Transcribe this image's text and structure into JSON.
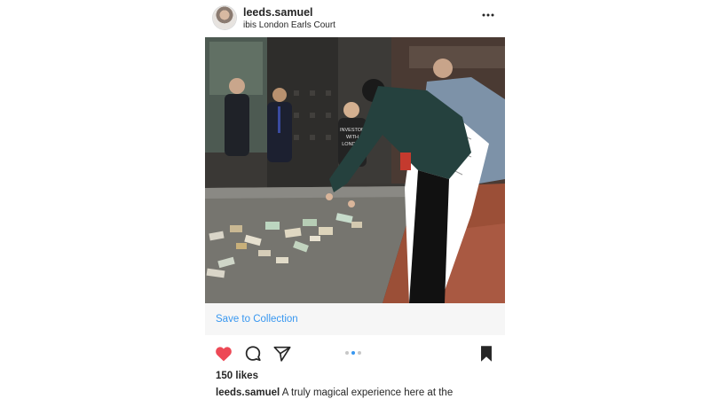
{
  "post": {
    "username": "leeds.samuel",
    "location": "ibis London Earls Court",
    "save_to_collection": "Save to Collection",
    "likes": "150 likes",
    "caption_user": "leeds.samuel",
    "caption_text": "A truly magical experience here at the",
    "carousel": {
      "total": 3,
      "active_index": 1
    },
    "liked": true,
    "saved": true
  },
  "photo": {
    "shirt_text": [
      "INVESTOR",
      "WITH",
      "LONDON"
    ]
  },
  "icons": {
    "more": "more-horizontal-icon",
    "like": "heart-icon",
    "comment": "comment-bubble-icon",
    "share": "send-paper-plane-icon",
    "save": "bookmark-icon"
  },
  "colors": {
    "like": "#ed4956",
    "link": "#3897f0",
    "text": "#262626",
    "save_bar_bg": "#f6f6f6"
  }
}
